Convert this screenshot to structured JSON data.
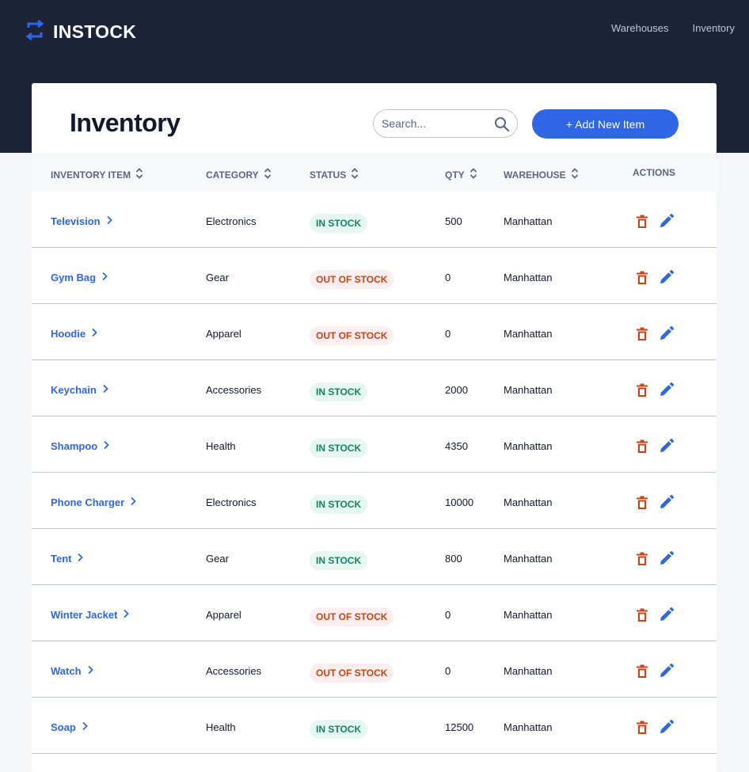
{
  "header": {
    "logo_text": "INSTOCK",
    "nav": [
      "Warehouses",
      "Inventory"
    ]
  },
  "main": {
    "title": "Inventory",
    "search_placeholder": "Search...",
    "add_button": "+ Add New Item"
  },
  "table": {
    "columns": [
      "INVENTORY ITEM",
      "CATEGORY",
      "STATUS",
      "QTY",
      "WAREHOUSE",
      "ACTIONS"
    ],
    "rows": [
      {
        "item": "Television",
        "category": "Electronics",
        "status": "IN STOCK",
        "qty": "500",
        "warehouse": "Manhattan"
      },
      {
        "item": "Gym Bag",
        "category": "Gear",
        "status": "OUT OF STOCK",
        "qty": "0",
        "warehouse": "Manhattan"
      },
      {
        "item": "Hoodie",
        "category": "Apparel",
        "status": "OUT OF STOCK",
        "qty": "0",
        "warehouse": "Manhattan"
      },
      {
        "item": "Keychain",
        "category": "Accessories",
        "status": "IN STOCK",
        "qty": "2000",
        "warehouse": "Manhattan"
      },
      {
        "item": "Shampoo",
        "category": "Health",
        "status": "IN STOCK",
        "qty": "4350",
        "warehouse": "Manhattan"
      },
      {
        "item": "Phone Charger",
        "category": "Electronics",
        "status": "IN STOCK",
        "qty": "10000",
        "warehouse": "Manhattan"
      },
      {
        "item": "Tent",
        "category": "Gear",
        "status": "IN STOCK",
        "qty": "800",
        "warehouse": "Manhattan"
      },
      {
        "item": "Winter Jacket",
        "category": "Apparel",
        "status": "OUT OF STOCK",
        "qty": "0",
        "warehouse": "Manhattan"
      },
      {
        "item": "Watch",
        "category": "Accessories",
        "status": "OUT OF STOCK",
        "qty": "0",
        "warehouse": "Manhattan"
      },
      {
        "item": "Soap",
        "category": "Health",
        "status": "IN STOCK",
        "qty": "12500",
        "warehouse": "Manhattan"
      }
    ]
  },
  "colors": {
    "header_bg": "#1e2438",
    "accent": "#2e66e5",
    "in_stock_text": "#158463",
    "in_stock_bg": "#e6f7f1",
    "out_of_stock_text": "#c94515",
    "out_of_stock_bg": "#fceeee",
    "delete_icon": "#c94515"
  },
  "icons": {
    "logo": "swap-arrows-icon",
    "search": "search-icon",
    "sort": "sort-icon",
    "chevron": "chevron-right-icon",
    "delete": "trash-icon",
    "edit": "pencil-icon"
  }
}
